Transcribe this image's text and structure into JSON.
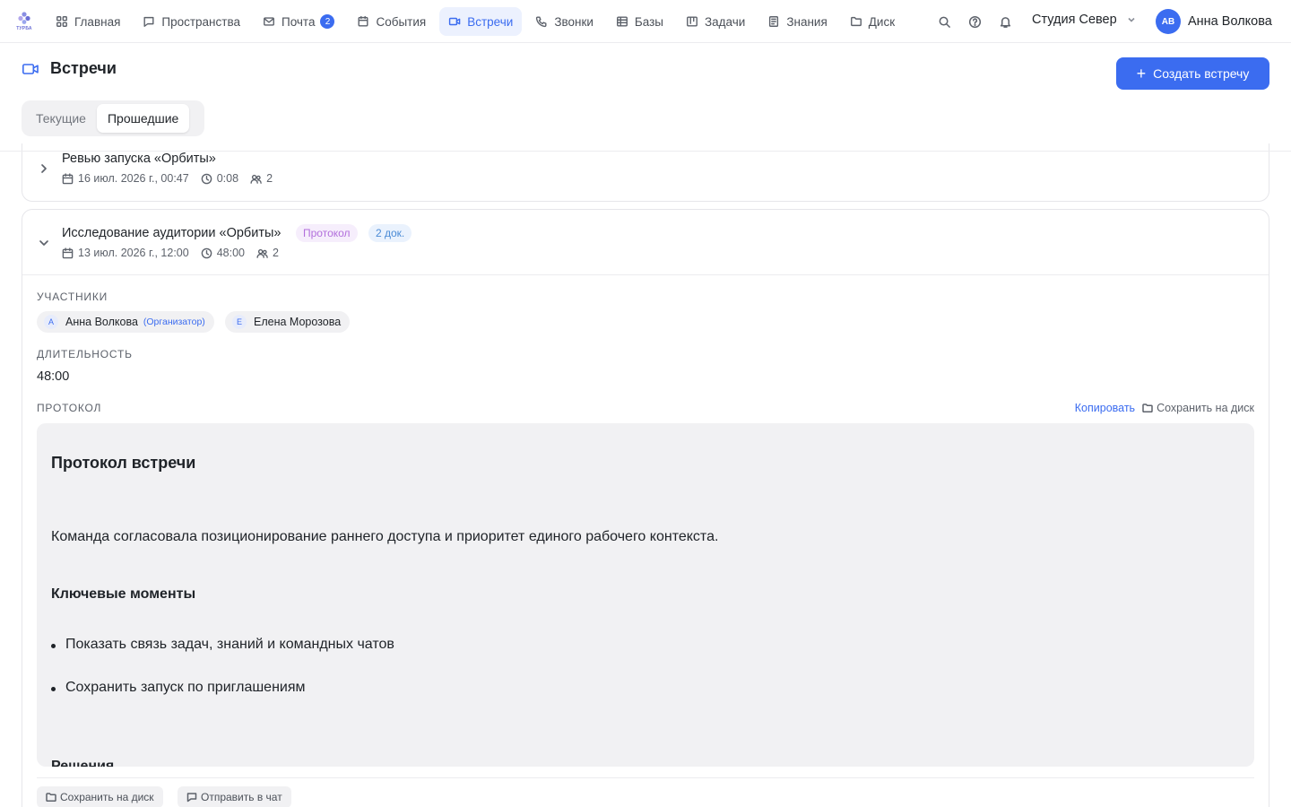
{
  "app": {
    "logo_text": "ТУРБА"
  },
  "nav": {
    "items": [
      {
        "label": "Главная"
      },
      {
        "label": "Пространства"
      },
      {
        "label": "Почта",
        "badge": "2"
      },
      {
        "label": "События"
      },
      {
        "label": "Встречи",
        "active": true
      },
      {
        "label": "Звонки"
      },
      {
        "label": "Базы"
      },
      {
        "label": "Задачи"
      },
      {
        "label": "Знания"
      },
      {
        "label": "Диск"
      }
    ]
  },
  "header": {
    "workspace": "Студия Север",
    "user": {
      "initials": "АВ",
      "name": "Анна Волкова"
    }
  },
  "page": {
    "title": "Встречи",
    "create_label": "Создать встречу",
    "tabs": [
      {
        "label": "Текущие"
      },
      {
        "label": "Прошедшие",
        "active": true
      }
    ]
  },
  "meetings": [
    {
      "title": "Ревью запуска «Орбиты»",
      "date": "16 июл. 2026 г., 00:47",
      "duration": "0:08",
      "participants": "2"
    },
    {
      "title": "Исследование аудитории «Орбиты»",
      "badges": {
        "protocol": "Протокол",
        "docs": "2 док."
      },
      "date": "13 июл. 2026 г., 12:00",
      "duration": "48:00",
      "participants": "2",
      "details": {
        "participants_label": "Участники",
        "people": [
          {
            "initial": "А",
            "name": "Анна Волкова",
            "role": "(Организатор)"
          },
          {
            "initial": "Е",
            "name": "Елена Морозова"
          }
        ],
        "duration_label": "Длительность",
        "duration_value": "48:00",
        "protocol_label": "Протокол",
        "copy_label": "Копировать",
        "save_label": "Сохранить на диск",
        "protocol": {
          "heading": "Протокол встречи",
          "summary": "Команда согласовала позиционирование раннего доступа и приоритет единого рабочего контекста.",
          "key_points_heading": "Ключевые моменты",
          "key_points": [
            "Показать связь задач, знаний и командных чатов",
            "Сохранить запуск по приглашениям"
          ],
          "decisions_heading": "Решения"
        },
        "footer": {
          "save_label": "Сохранить на диск",
          "send_label": "Отправить в чат"
        }
      }
    }
  ],
  "colors": {
    "accent": "#3b6cf0",
    "purple_badge": "#b26fdc",
    "blue_badge": "#4b8bd6"
  }
}
